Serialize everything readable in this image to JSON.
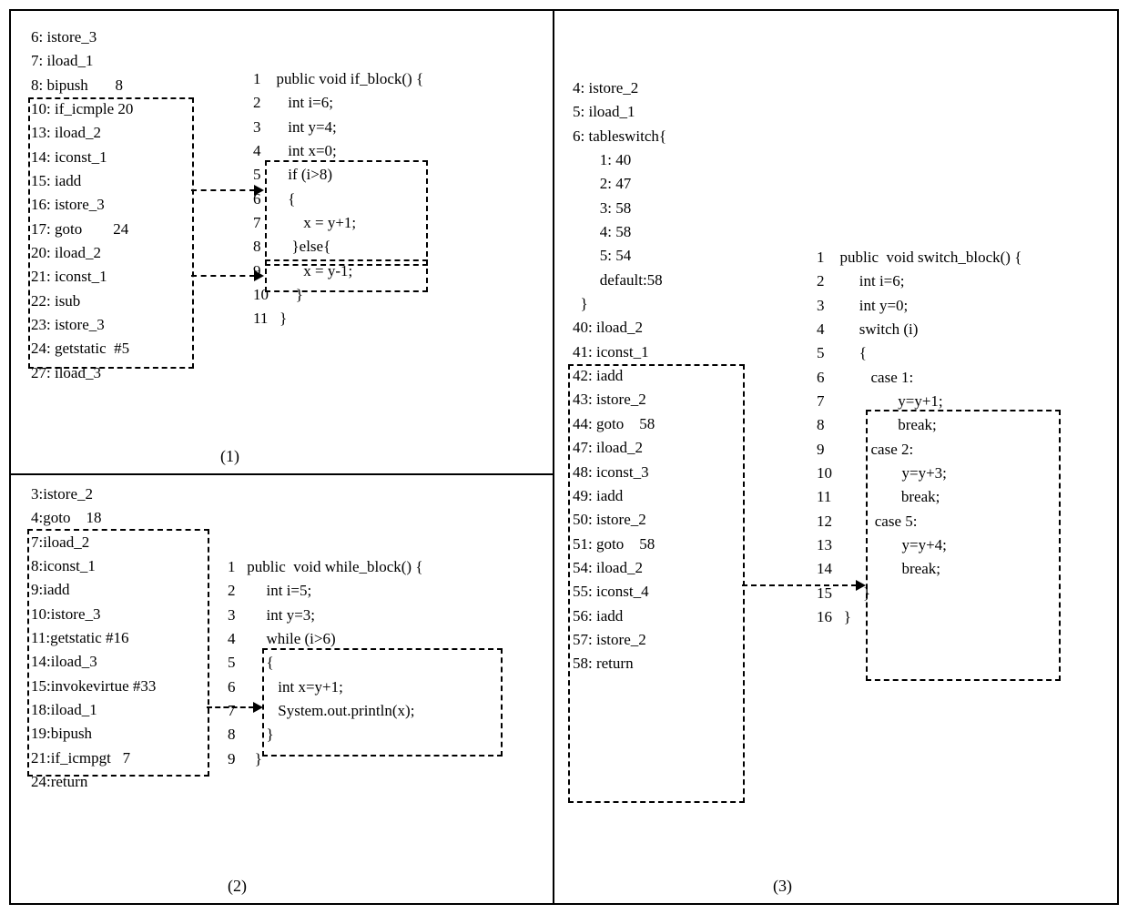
{
  "panel1": {
    "caption": "(1)",
    "bytecode": [
      "6: istore_3",
      "7: iload_1",
      "8: bipush       8",
      "10: if_icmple 20",
      "13: iload_2",
      "14: iconst_1",
      "15: iadd",
      "16: istore_3",
      "17: goto        24",
      "20: iload_2",
      "21: iconst_1",
      "22: isub",
      "23: istore_3",
      "24: getstatic  #5",
      "27: iload_3"
    ],
    "source": [
      "1    public void if_block() {",
      "2       int i=6;",
      "3       int y=4;",
      "4       int x=0;",
      "5       if (i>8)",
      "6       {",
      "7           x = y+1;",
      "8        }else{",
      "9           x = y-1;",
      "10       }",
      "11   }"
    ]
  },
  "panel2": {
    "caption": "(2)",
    "bytecode": [
      "3:istore_2",
      "4:goto    18",
      "7:iload_2",
      "8:iconst_1",
      "9:iadd",
      "10:istore_3",
      "11:getstatic #16",
      "14:iload_3",
      "15:invokevirtue #33",
      "18:iload_1",
      "19:bipush",
      "21:if_icmpgt   7",
      "24:return"
    ],
    "source": [
      "1   public  void while_block() {",
      "2        int i=5;",
      "3        int y=3;",
      "4        while (i>6)",
      "5        {",
      "6           int x=y+1;",
      "7           System.out.println(x);",
      "8        }",
      "9     }"
    ]
  },
  "panel3": {
    "caption": "(3)",
    "bytecode": [
      "4: istore_2",
      "5: iload_1",
      "6: tableswitch{",
      "       1: 40",
      "       2: 47",
      "       3: 58",
      "       4: 58",
      "       5: 54",
      "       default:58",
      "  }",
      "40: iload_2",
      "41: iconst_1",
      "42: iadd",
      "43: istore_2",
      "44: goto    58",
      "47: iload_2",
      "48: iconst_3",
      "49: iadd",
      "50: istore_2",
      "51: goto    58",
      "54: iload_2",
      "55: iconst_4",
      "56: iadd",
      "57: istore_2",
      "58: return"
    ],
    "source": [
      "1    public  void switch_block() {",
      "2         int i=6;",
      "3         int y=0;",
      "4         switch (i)",
      "5         {",
      "6            case 1:",
      "7                   y=y+1;",
      "8                   break;",
      "9            case 2:",
      "10                  y=y+3;",
      "11                  break;",
      "12           case 5:",
      "13                  y=y+4;",
      "14                  break;",
      "15        }",
      "16   }"
    ]
  }
}
